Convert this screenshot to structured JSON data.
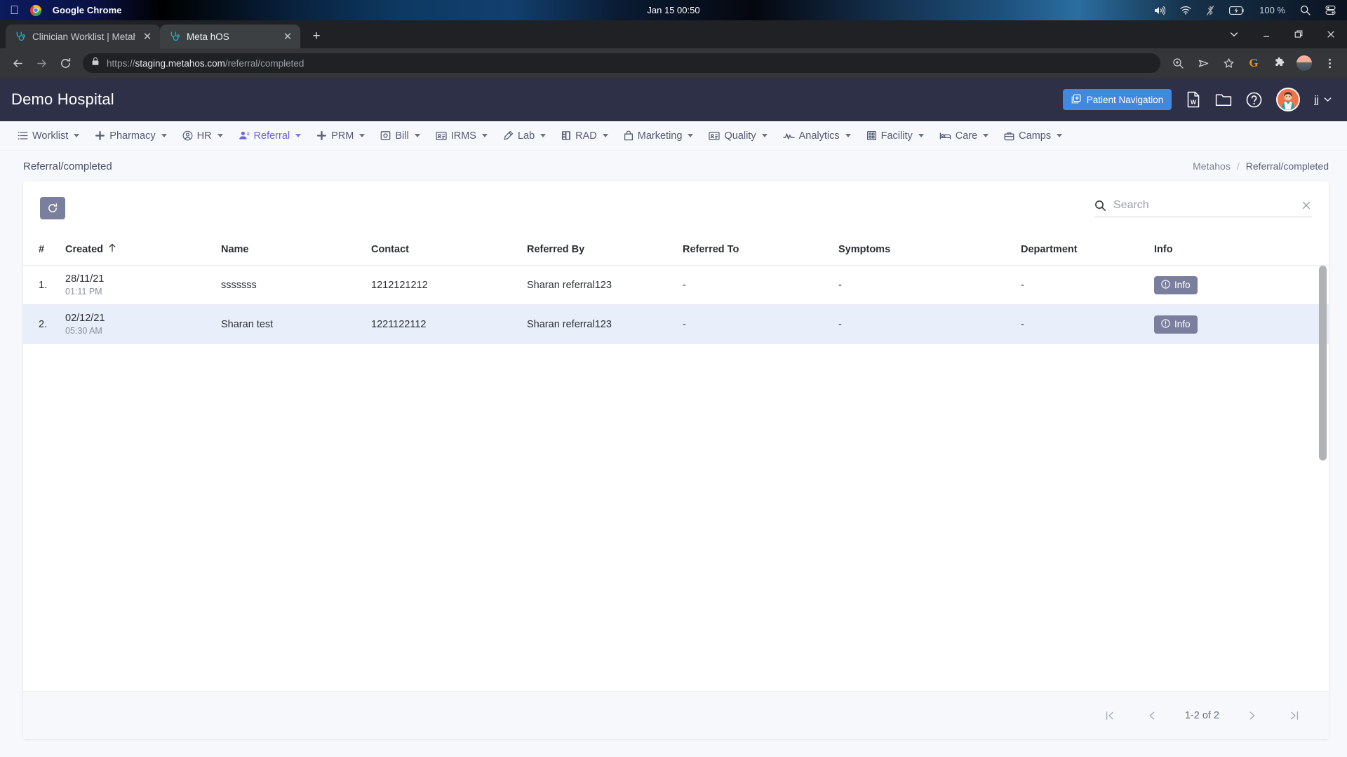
{
  "os_bar": {
    "apple_icon": "apple-logo",
    "app_name": "Google Chrome",
    "clock": "Jan 15  00:50",
    "battery_percent": "100 %",
    "tray_icons": [
      "volume-icon",
      "wifi-icon",
      "bluetooth-off-icon",
      "battery-icon",
      "spotlight-search-icon",
      "control-center-icon"
    ]
  },
  "browser": {
    "tabs": [
      {
        "title": "Clinician Worklist | Metah",
        "favicon": "stethoscope-favicon",
        "active": false
      },
      {
        "title": "Meta hOS",
        "favicon": "stethoscope-favicon",
        "active": true
      }
    ],
    "new_tab_label": "+",
    "window_controls": [
      "chevron-down-icon",
      "minimize-icon",
      "restore-icon",
      "close-icon"
    ],
    "nav": {
      "back": "back-arrow-icon",
      "forward": "forward-arrow-icon",
      "reload": "reload-icon"
    },
    "url": {
      "scheme": "https://",
      "host": "staging.metahos.com",
      "path": "/referral/completed",
      "lock": "lock-icon"
    },
    "toolbar_icons": [
      "zoom-in-icon",
      "send-icon",
      "bookmark-star-icon",
      "grammarly-extension-icon",
      "extensions-puzzle-icon",
      "profile-avatar-icon",
      "chrome-menu-icon"
    ]
  },
  "app_header": {
    "brand": "Demo Hospital",
    "patient_navigation_label": "Patient Navigation",
    "icons": [
      "word-document-icon",
      "folder-icon",
      "help-circle-icon"
    ],
    "user": {
      "name": "jj",
      "avatar": "doctor-avatar"
    }
  },
  "nav": {
    "items": [
      {
        "label": "Worklist",
        "icon": "list-icon",
        "active": false
      },
      {
        "label": "Pharmacy",
        "icon": "plus-icon",
        "active": false
      },
      {
        "label": "HR",
        "icon": "user-circle-icon",
        "active": false
      },
      {
        "label": "Referral",
        "icon": "users-icon",
        "active": true
      },
      {
        "label": "PRM",
        "icon": "plus-icon",
        "active": false
      },
      {
        "label": "Bill",
        "icon": "receipt-icon",
        "active": false
      },
      {
        "label": "IRMS",
        "icon": "id-card-icon",
        "active": false
      },
      {
        "label": "Lab",
        "icon": "pipette-icon",
        "active": false
      },
      {
        "label": "RAD",
        "icon": "film-icon",
        "active": false
      },
      {
        "label": "Marketing",
        "icon": "bag-icon",
        "active": false
      },
      {
        "label": "Quality",
        "icon": "id-card-icon",
        "active": false
      },
      {
        "label": "Analytics",
        "icon": "pulse-icon",
        "active": false
      },
      {
        "label": "Facility",
        "icon": "building-icon",
        "active": false
      },
      {
        "label": "Care",
        "icon": "bed-icon",
        "active": false
      },
      {
        "label": "Camps",
        "icon": "briefcase-icon",
        "active": false
      }
    ]
  },
  "page": {
    "title": "Referral/completed",
    "breadcrumb": {
      "root": "Metahos",
      "separator": "/",
      "current": "Referral/completed"
    }
  },
  "toolbar": {
    "refresh_icon": "refresh-icon",
    "search": {
      "placeholder": "Search",
      "value": "",
      "icon": "search-icon",
      "clear_icon": "close-icon"
    }
  },
  "table": {
    "columns": [
      {
        "key": "num",
        "label": "#",
        "sorted": false
      },
      {
        "key": "created",
        "label": "Created",
        "sorted": true,
        "sort_dir": "asc",
        "sort_icon": "arrow-up-icon"
      },
      {
        "key": "name",
        "label": "Name",
        "sorted": false
      },
      {
        "key": "contact",
        "label": "Contact",
        "sorted": false
      },
      {
        "key": "refby",
        "label": "Referred By",
        "sorted": false
      },
      {
        "key": "refto",
        "label": "Referred To",
        "sorted": false
      },
      {
        "key": "symp",
        "label": "Symptoms",
        "sorted": false
      },
      {
        "key": "dept",
        "label": "Department",
        "sorted": false
      },
      {
        "key": "info",
        "label": "Info",
        "sorted": false
      }
    ],
    "rows": [
      {
        "num": "1.",
        "created_date": "28/11/21",
        "created_time": "01:11 PM",
        "name": "sssssss",
        "contact": "1212121212",
        "referred_by": "Sharan referral123",
        "referred_to": "-",
        "symptoms": "-",
        "department": "-",
        "info_label": "Info"
      },
      {
        "num": "2.",
        "created_date": "02/12/21",
        "created_time": "05:30 AM",
        "name": "Sharan test",
        "contact": "1221122112",
        "referred_by": "Sharan referral123",
        "referred_to": "-",
        "symptoms": "-",
        "department": "-",
        "info_label": "Info"
      }
    ]
  },
  "pagination": {
    "first_icon": "first-page-icon",
    "prev_icon": "prev-page-icon",
    "range_label": "1-2 of 2",
    "next_icon": "next-page-icon",
    "last_icon": "last-page-icon"
  },
  "colors": {
    "header_bg": "#2e3047",
    "accent_blue": "#3f8ae0",
    "active_nav": "#6c63e0",
    "button_muted": "#7b7f9e",
    "row_alt": "#e8effa",
    "page_bg": "#f7f8fb"
  }
}
